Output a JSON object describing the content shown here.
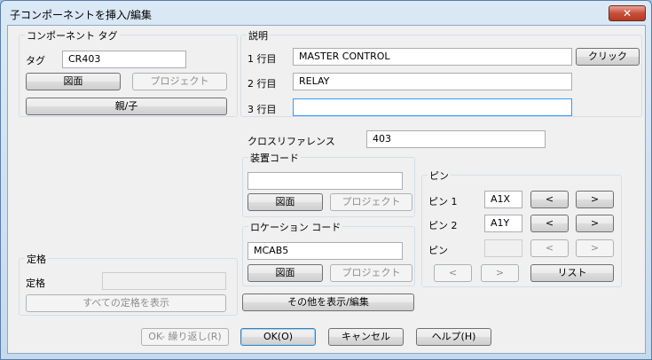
{
  "window": {
    "title": "子コンポーネントを挿入/編集",
    "close_glyph": "✕"
  },
  "component_tag": {
    "group_title": "コンポーネント タグ",
    "tag_label": "タグ",
    "tag_value": "CR403",
    "drawing_btn": "図面",
    "project_btn": "プロジェクト",
    "parent_child_btn": "親/子"
  },
  "description": {
    "group_title": "説明",
    "line1_label": "1 行目",
    "line1_value": "MASTER CONTROL",
    "line2_label": "2 行目",
    "line2_value": "RELAY",
    "line3_label": "3 行目",
    "line3_value": "",
    "pick_btn": "クリック"
  },
  "cross_reference": {
    "label": "クロスリファレンス",
    "value": "403"
  },
  "installation": {
    "group_title": "装置コード",
    "value": "",
    "drawing_btn": "図面",
    "project_btn": "プロジェクト"
  },
  "location": {
    "group_title": "ロケーション コード",
    "value": "MCAB5",
    "drawing_btn": "図面",
    "project_btn": "プロジェクト"
  },
  "pins": {
    "group_title": "ピン",
    "pin1_label": "ピン 1",
    "pin1_value": "A1X",
    "pin2_label": "ピン 2",
    "pin2_value": "A1Y",
    "pin3_label": "ピン",
    "pin3_value": "",
    "prev_glyph": "<",
    "next_glyph": ">",
    "list_btn": "リスト"
  },
  "rating": {
    "group_title": "定格",
    "rating_label": "定格",
    "rating_value": "",
    "show_all_btn": "すべての定格を表示"
  },
  "buttons": {
    "show_edit_misc": "その他を表示/編集",
    "ok_repeat": "OK- 繰り返し(R)",
    "ok": "OK(O)",
    "cancel": "キャンセル",
    "help": "ヘルプ(H)"
  }
}
